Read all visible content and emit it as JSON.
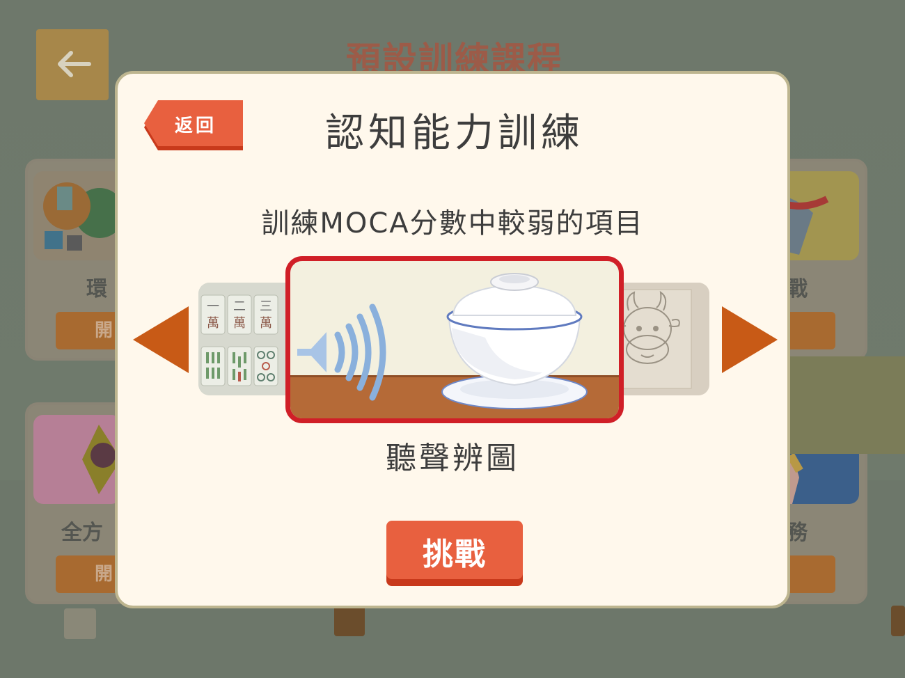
{
  "background": {
    "title": "預設訓練課程",
    "cards_left": [
      "環",
      "全方"
    ],
    "cards_right": [
      "戰",
      "務"
    ],
    "card_button_text": "開"
  },
  "dialog": {
    "back_label": "返回",
    "title": "認知能力訓練",
    "subtitle": "訓練MOCA分數中較弱的項目",
    "current_game": "聽聲辨圖",
    "challenge_label": "挑戰",
    "mahjong_tiles": [
      "一",
      "二",
      "三"
    ],
    "mahjong_suit": "萬"
  },
  "colors": {
    "accent": "#e8603f",
    "card_border": "#d01f27",
    "arrow": "#c85a16",
    "dialog_bg": "#fff8ec"
  }
}
